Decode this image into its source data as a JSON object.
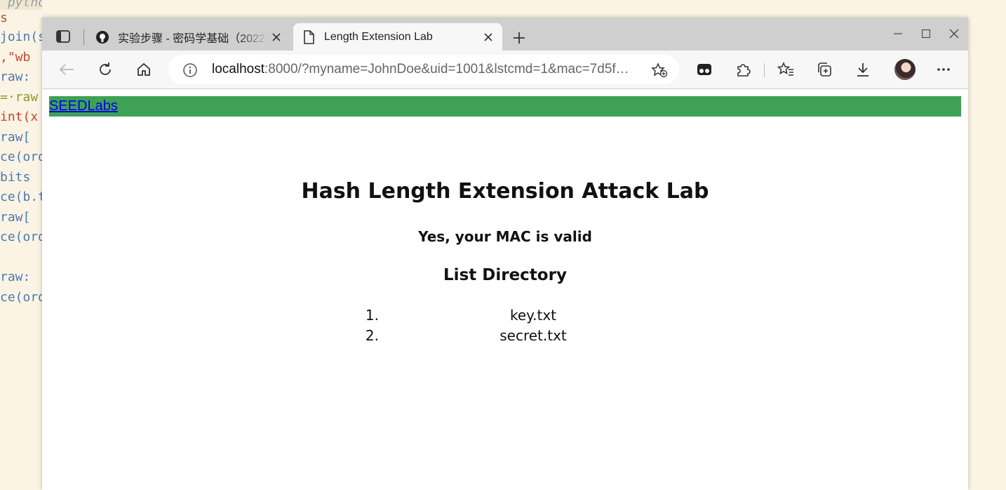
{
  "background_editor": {
    "lines": [
      " pytho",
      "s",
      "join(s",
      ",\"wb",
      "raw:",
      "=·raw",
      "int(x",
      "raw[",
      "ce(ord",
      "bits",
      "ce(b.t",
      "raw[",
      "ce(ord",
      "raw:",
      "ce(ord"
    ]
  },
  "browser": {
    "tabs": [
      {
        "title": "实验步骤 - 密码学基础（2022",
        "favicon": "github-icon",
        "active": false
      },
      {
        "title": "Length Extension Lab",
        "favicon": "page-icon",
        "active": true
      }
    ],
    "address": {
      "host": "localhost",
      "rest": ":8000/?myname=JohnDoe&uid=1001&lstcmd=1&mac=7d5f…"
    },
    "icons": [
      "back-icon",
      "refresh-icon",
      "home-icon",
      "site-info-icon",
      "add-favorite-icon",
      "reading-icon",
      "extensions-icon",
      "favorites-icon",
      "collections-icon",
      "downloads-icon",
      "avatar",
      "more-icon"
    ]
  },
  "page": {
    "nav_link": "SEEDLabs",
    "heading": "Hash Length Extension Attack Lab",
    "message": "Yes, your MAC is valid",
    "list_heading": "List Directory",
    "files": [
      {
        "num": "1.",
        "name": "key.txt"
      },
      {
        "num": "2.",
        "name": "secret.txt"
      }
    ]
  },
  "colors": {
    "topbar": "#3ea154",
    "link": "#0000ee",
    "desktop_bg": "#fbf4e4"
  }
}
